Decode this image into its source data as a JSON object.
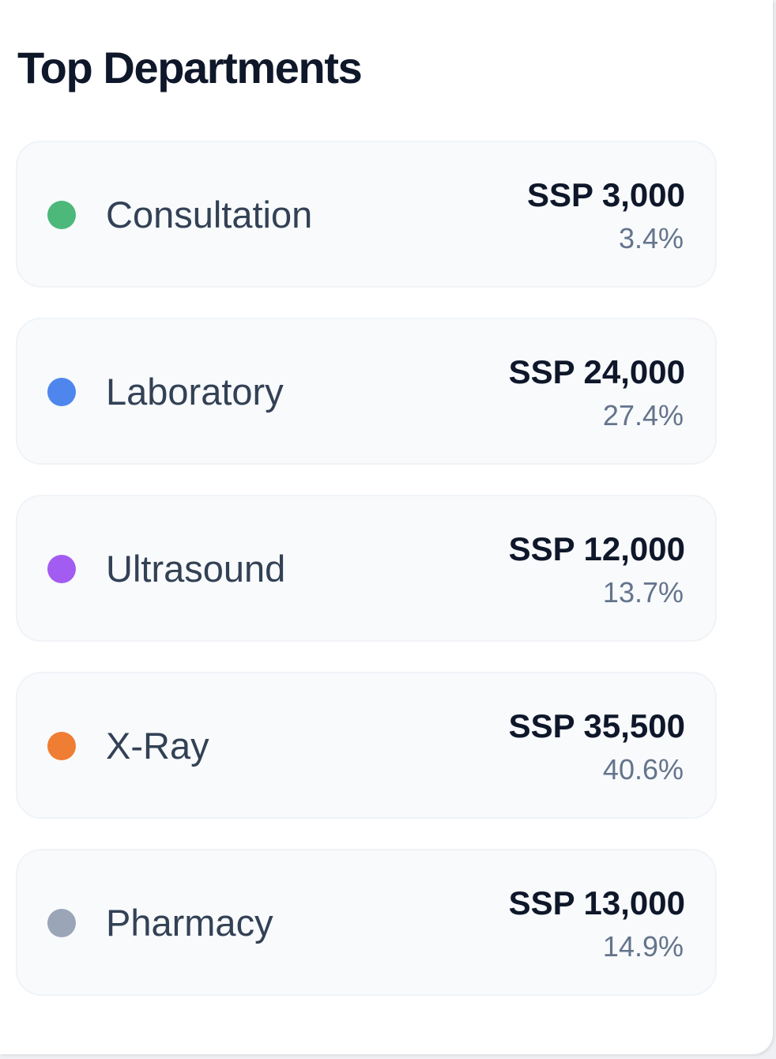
{
  "card": {
    "title": "Top Departments"
  },
  "departments": [
    {
      "name": "Consultation",
      "amount": "SSP 3,000",
      "share": "3.4%",
      "color": "#4cb87a"
    },
    {
      "name": "Laboratory",
      "amount": "SSP 24,000",
      "share": "27.4%",
      "color": "#4f86ee"
    },
    {
      "name": "Ultrasound",
      "amount": "SSP 12,000",
      "share": "13.7%",
      "color": "#a35cf2"
    },
    {
      "name": "X-Ray",
      "amount": "SSP 35,500",
      "share": "40.6%",
      "color": "#ef7d33"
    },
    {
      "name": "Pharmacy",
      "amount": "SSP 13,000",
      "share": "14.9%",
      "color": "#9aa5b8"
    }
  ]
}
